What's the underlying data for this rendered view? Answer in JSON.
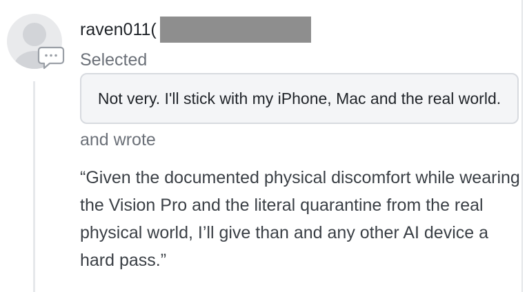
{
  "comment": {
    "username": "raven011(",
    "selected_label": "Selected",
    "selected_option": "Not very. I'll stick with my iPhone, Mac and the real world.",
    "wrote_label": "and wrote",
    "quote": "“Given the documented physical discomfort while wearing the Vision Pro and the literal quarantine from the real physical world, I’ll give than and any other AI device a hard pass.”"
  },
  "icons": {
    "avatar": "default-user-avatar-icon",
    "comment": "speech-bubble-icon"
  },
  "colors": {
    "avatar_gray": "#d7d9dc",
    "muted_text": "#6b7078",
    "option_bg": "#f4f5f7",
    "redaction": "#8e8e8e"
  }
}
